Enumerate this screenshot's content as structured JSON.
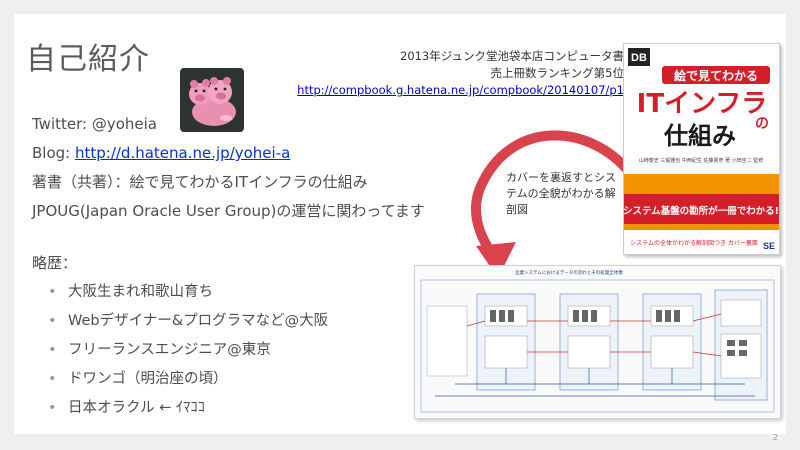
{
  "slide": {
    "title": "自己紹介",
    "info_lines": [
      {
        "prefix": "Twitter: @yoheia"
      },
      {
        "prefix": "Blog: ",
        "link": "http://d.hatena.ne.jp/yohei-a"
      },
      {
        "prefix": "著書（共著）：絵で見てわかるITインフラの仕組み"
      },
      {
        "prefix": "JPOUG(Japan Oracle User Group)の運営に関わってます"
      }
    ],
    "history_title": "略歴：",
    "history": [
      "大阪生まれ和歌山育ち",
      "Webデザイナー&プログラマなど@大阪",
      "フリーランスエンジニア@東京",
      "ドワンゴ（明治座の頃）",
      "日本オラクル ← ｲﾏｺｺ"
    ],
    "bullet": "•",
    "ranking": {
      "line1": "2013年ジュンク堂池袋本店コンピュータ書",
      "line2": "売上冊数ランキング第5位",
      "url": "http://compbook.g.hatena.ne.jp/compbook/20140107/p1"
    },
    "caption": "カバーを裏返すとシステムの全貌がわかる解剖図",
    "page_number": "2"
  },
  "book": {
    "badge": "DB",
    "title_top": "絵で見てわかる",
    "title_main": "ITインフラ",
    "title_no": "の",
    "title_bottom": "仕組み",
    "authors": "山崎泰史 三堀雅也 中西紀生 佐藤貴彦 著 小田圭二 監修",
    "band": "システム基盤の勘所が一冊でわかる!",
    "footer": "システムの全体がわかる解剖図つき カバー裏面",
    "publisher": "SE"
  },
  "diagram": {
    "title": "企業システムにおけるデータの流れとその処理全体像"
  },
  "colors": {
    "accent_arrow": "#d9434e",
    "book_red": "#d51f28",
    "book_orange": "#f29400",
    "link_blue": "#0033cc"
  }
}
